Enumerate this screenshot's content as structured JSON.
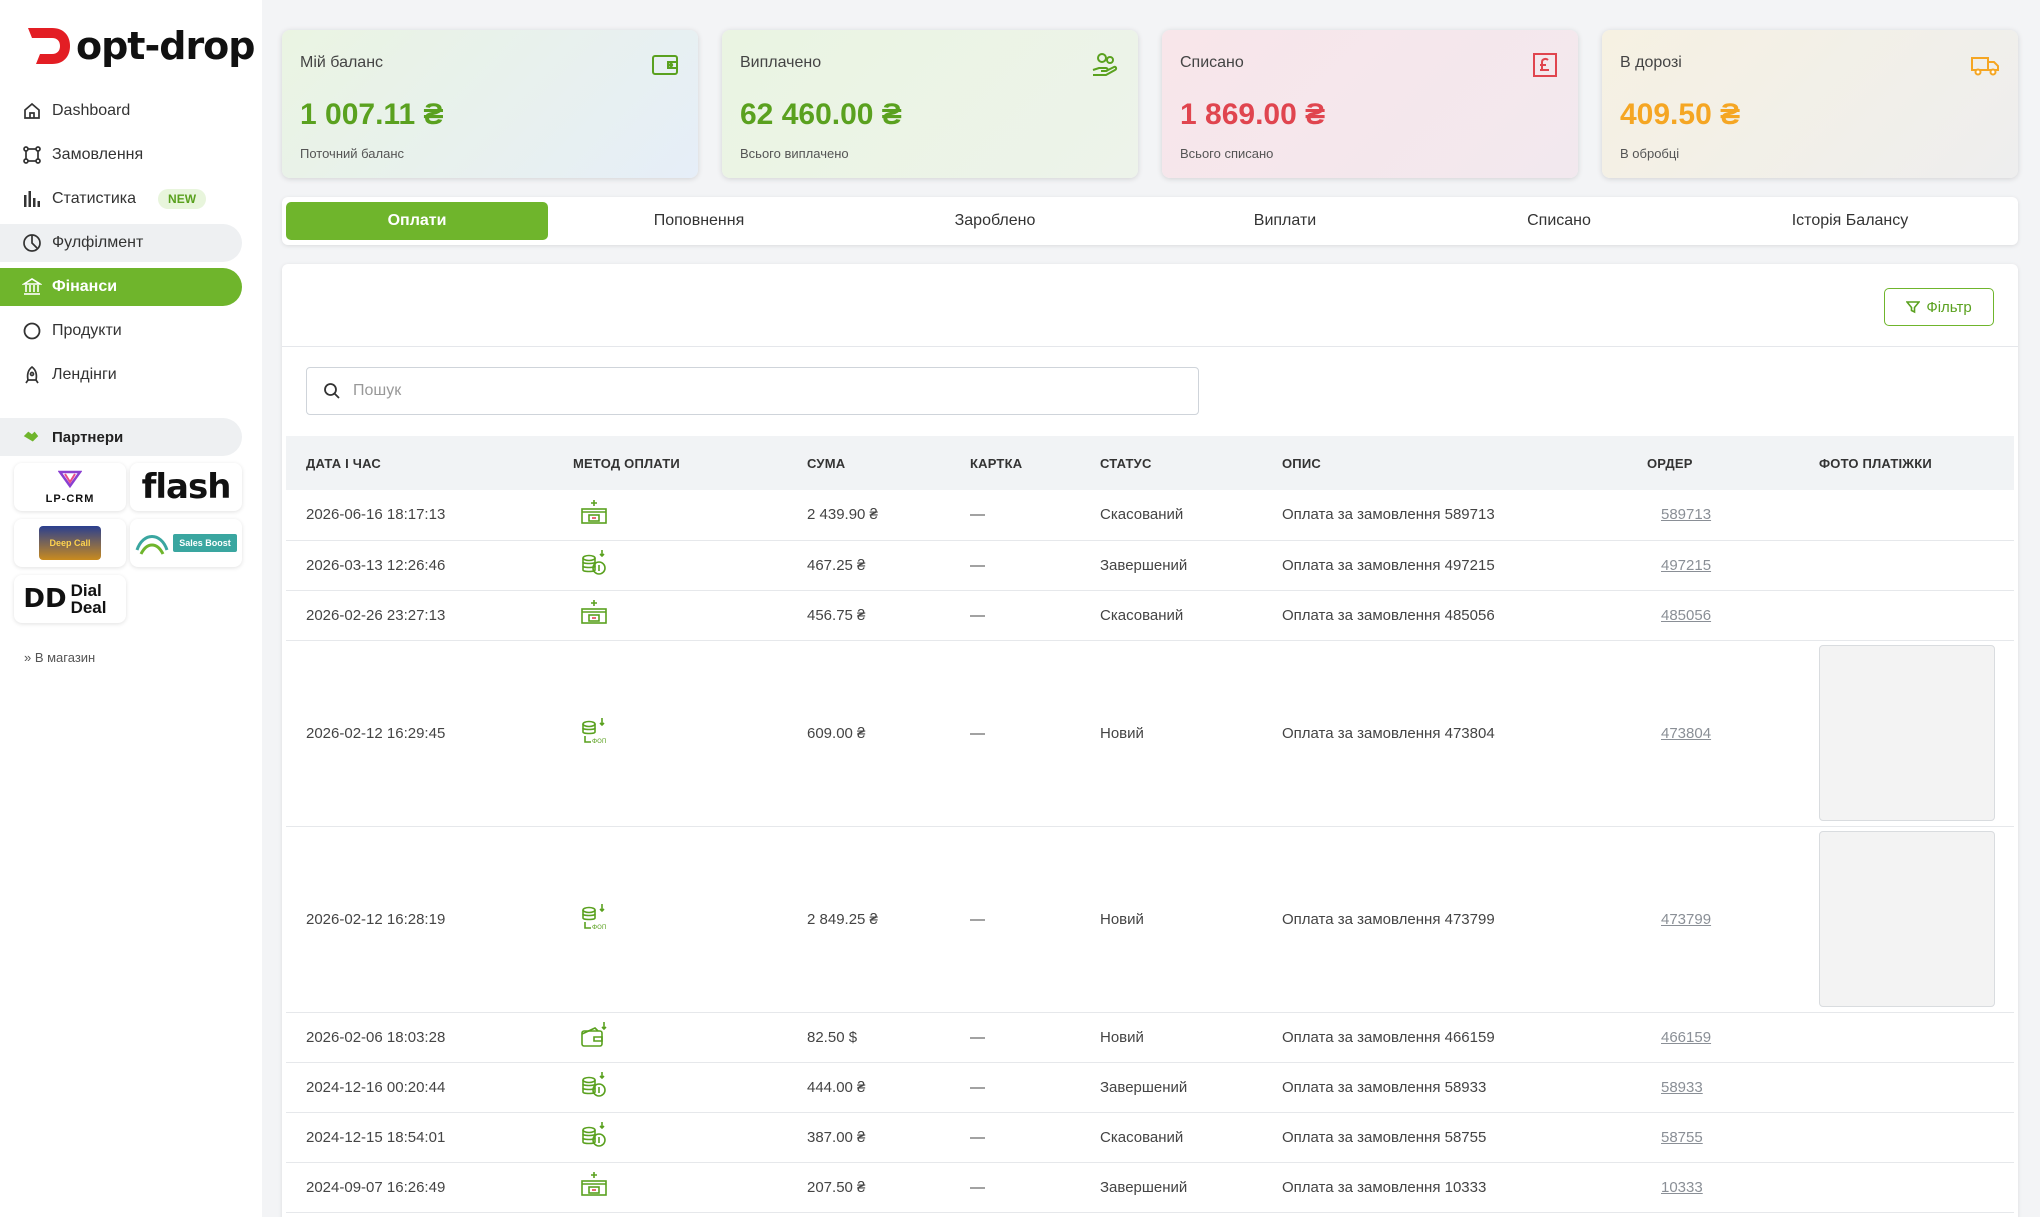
{
  "brand": {
    "name": "opt-drop",
    "accent": "#6fb52c"
  },
  "sidebar": {
    "items": [
      {
        "label": "Dashboard",
        "icon": "home-icon"
      },
      {
        "label": "Замовлення",
        "icon": "orders-icon"
      },
      {
        "label": "Статистика",
        "icon": "stats-icon",
        "badge": "NEW"
      },
      {
        "label": "Фулфілмент",
        "icon": "fulfillment-icon"
      },
      {
        "label": "Фінанси",
        "icon": "bank-icon"
      },
      {
        "label": "Продукти",
        "icon": "circle-icon"
      },
      {
        "label": "Лендінги",
        "icon": "rocket-icon"
      }
    ],
    "partners_label": "Партнери",
    "partners": [
      "LP-CRM",
      "flash",
      "Deep Call",
      "Sales Boost",
      "Dial Deal"
    ],
    "to_shop": "» В магазин"
  },
  "cards": [
    {
      "title": "Мій баланс",
      "value": "1 007.11 ₴",
      "sub": "Поточний баланс",
      "color": "#5aa11f"
    },
    {
      "title": "Виплачено",
      "value": "62 460.00 ₴",
      "sub": "Всього виплачено",
      "color": "#5aa11f"
    },
    {
      "title": "Списано",
      "value": "1 869.00 ₴",
      "sub": "Всього списано",
      "color": "#e0454f"
    },
    {
      "title": "В дорозі",
      "value": "409.50 ₴",
      "sub": "В обробці",
      "color": "#f5a623"
    }
  ],
  "tabs": [
    "Оплати",
    "Поповнення",
    "Зароблено",
    "Виплати",
    "Списано",
    "Історія Балансу"
  ],
  "filter_label": "Фільтр",
  "search": {
    "placeholder": "Пошук"
  },
  "table": {
    "headers": [
      "ДАТА І ЧАС",
      "МЕТОД ОПЛАТИ",
      "СУМА",
      "КАРТКА",
      "СТАТУС",
      "ОПИС",
      "ОРДЕР",
      "ФОТО ПЛАТІЖКИ"
    ],
    "rows": [
      {
        "date": "2026-06-16 18:17:13",
        "method": "cash-register-icon",
        "sum": "2 439.90 ₴",
        "card": "—",
        "status": "Скасований",
        "desc": "Оплата за замовлення 589713",
        "order": "589713",
        "photo": false
      },
      {
        "date": "2026-03-13 12:26:46",
        "method": "coins-icon",
        "sum": "467.25 ₴",
        "card": "—",
        "status": "Завершений",
        "desc": "Оплата за замовлення 497215",
        "order": "497215",
        "photo": false
      },
      {
        "date": "2026-02-26 23:27:13",
        "method": "cash-register-icon",
        "sum": "456.75 ₴",
        "card": "—",
        "status": "Скасований",
        "desc": "Оплата за замовлення 485056",
        "order": "485056",
        "photo": false
      },
      {
        "date": "2026-02-12 16:29:45",
        "method": "fop-icon",
        "sum": "609.00 ₴",
        "card": "—",
        "status": "Новий",
        "desc": "Оплата за замовлення 473804",
        "order": "473804",
        "photo": true
      },
      {
        "date": "2026-02-12 16:28:19",
        "method": "fop-icon",
        "sum": "2 849.25 ₴",
        "card": "—",
        "status": "Новий",
        "desc": "Оплата за замовлення 473799",
        "order": "473799",
        "photo": true
      },
      {
        "date": "2026-02-06 18:03:28",
        "method": "wallet-icon",
        "sum": "82.50 $",
        "card": "—",
        "status": "Новий",
        "desc": "Оплата за замовлення 466159",
        "order": "466159",
        "photo": false
      },
      {
        "date": "2024-12-16 00:20:44",
        "method": "coins-icon",
        "sum": "444.00 ₴",
        "card": "—",
        "status": "Завершений",
        "desc": "Оплата за замовлення 58933",
        "order": "58933",
        "photo": false
      },
      {
        "date": "2024-12-15 18:54:01",
        "method": "coins-icon",
        "sum": "387.00 ₴",
        "card": "—",
        "status": "Скасований",
        "desc": "Оплата за замовлення 58755",
        "order": "58755",
        "photo": false
      },
      {
        "date": "2024-09-07 16:26:49",
        "method": "cash-register-icon",
        "sum": "207.50 ₴",
        "card": "—",
        "status": "Завершений",
        "desc": "Оплата за замовлення 10333",
        "order": "10333",
        "photo": false
      }
    ]
  }
}
